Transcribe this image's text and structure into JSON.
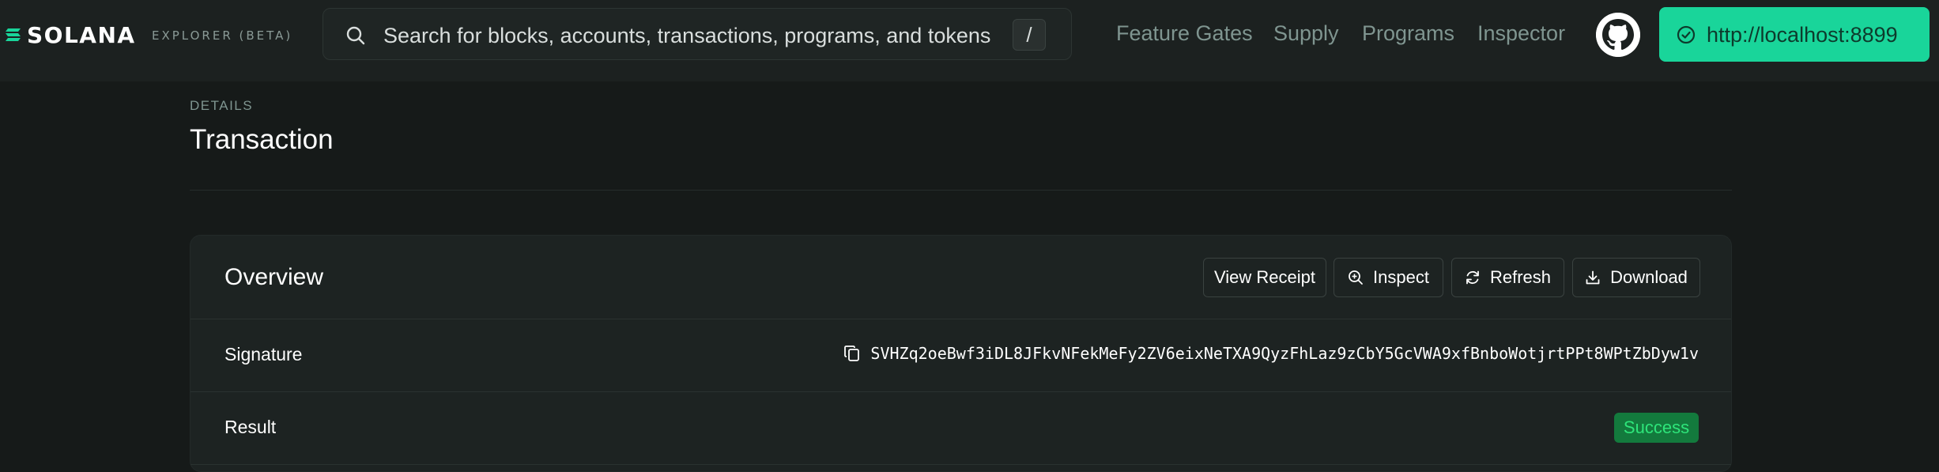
{
  "navbar": {
    "logo_text": "SOLANA",
    "logo_subtitle": "EXPLORER (BETA)",
    "search": {
      "placeholder": "Search for blocks, accounts, transactions, programs, and tokens",
      "shortcut": "/"
    },
    "links": [
      "Feature Gates",
      "Supply",
      "Programs",
      "Inspector"
    ],
    "github_icon": "github-icon",
    "cluster": {
      "label": "http://localhost:8899",
      "icon": "check-circle-icon"
    }
  },
  "header": {
    "pretitle": "DETAILS",
    "title": "Transaction"
  },
  "overview": {
    "title": "Overview",
    "buttons": {
      "view_receipt": "View Receipt",
      "inspect": "Inspect",
      "refresh": "Refresh",
      "download": "Download"
    },
    "rows": {
      "signature_label": "Signature",
      "signature_value": "SVHZq2oeBwf3iDL8JFkvNFekMeFy2ZV6eixNeTXA9QyzFhLaz9zCbY5GcVWA9xfBnboWotjrtPPt8WPtZbDyw1v",
      "result_label": "Result",
      "result_value": "Success"
    }
  },
  "colors": {
    "accent": "#19d59a",
    "background": "#161a19",
    "success": "#2ee57a"
  }
}
